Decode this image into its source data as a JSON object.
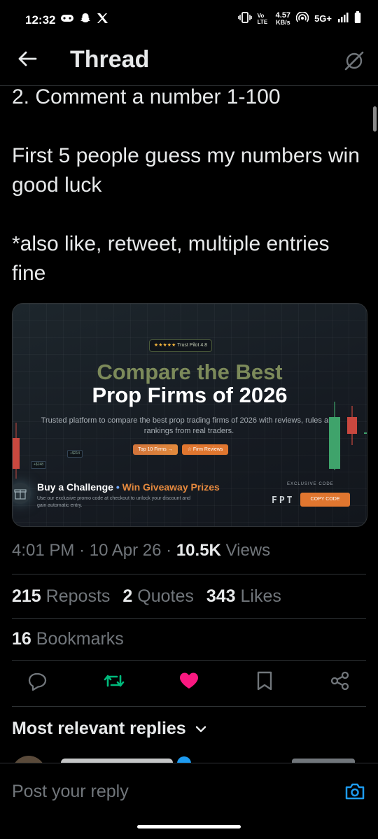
{
  "status": {
    "time": "12:32",
    "network_label": "Vo LTE",
    "speed_value": "4.57",
    "speed_unit": "KB/s",
    "signal_label": "5G+"
  },
  "header": {
    "title": "Thread"
  },
  "tweet": {
    "text": "2. Comment a number 1-100\n\nFirst 5 people guess my numbers win good luck\n\n*also like, retweet, multiple entries fine"
  },
  "media": {
    "trust_stars": "★★★★★",
    "trust_label": "Trust Pilot 4.8",
    "title_line1": "Compare the Best",
    "title_line2": "Prop Firms of 2026",
    "subtitle": "Trusted platform to compare the best prop trading firms of 2026 with reviews, rules and rankings from real traders.",
    "btn_top10": "Top 10 Firms →",
    "btn_reviews": "☆ Firm Reviews",
    "tag1": "+$214",
    "tag2": "+$248",
    "challenge_label": "Buy a Challenge",
    "challenge_dot": "•",
    "giveaway_label": "Win Giveaway Prizes",
    "challenge_sub": "Use our exclusive promo code at checkout to unlock your discount and gain automatic entry.",
    "exclusive_label": "EXCLUSIVE CODE",
    "code": "FPT",
    "copy_label": "COPY CODE"
  },
  "meta": {
    "time": "4:01 PM",
    "sep1": "·",
    "date": "10 Apr 26",
    "sep2": "·",
    "views_count": "10.5K",
    "views_label": "Views"
  },
  "stats": {
    "reposts_count": "215",
    "reposts_label": "Reposts",
    "quotes_count": "2",
    "quotes_label": "Quotes",
    "likes_count": "343",
    "likes_label": "Likes",
    "bookmarks_count": "16",
    "bookmarks_label": "Bookmarks"
  },
  "actions": [
    "reply-icon",
    "retweet-icon",
    "like-icon",
    "bookmark-icon",
    "share-icon"
  ],
  "colors": {
    "accent": "#1d9bf0",
    "retweet": "#00ba7c",
    "like": "#f91880",
    "muted": "#71767b"
  },
  "replies": {
    "sort_label": "Most relevant replies"
  },
  "compose": {
    "placeholder": "Post your reply"
  }
}
